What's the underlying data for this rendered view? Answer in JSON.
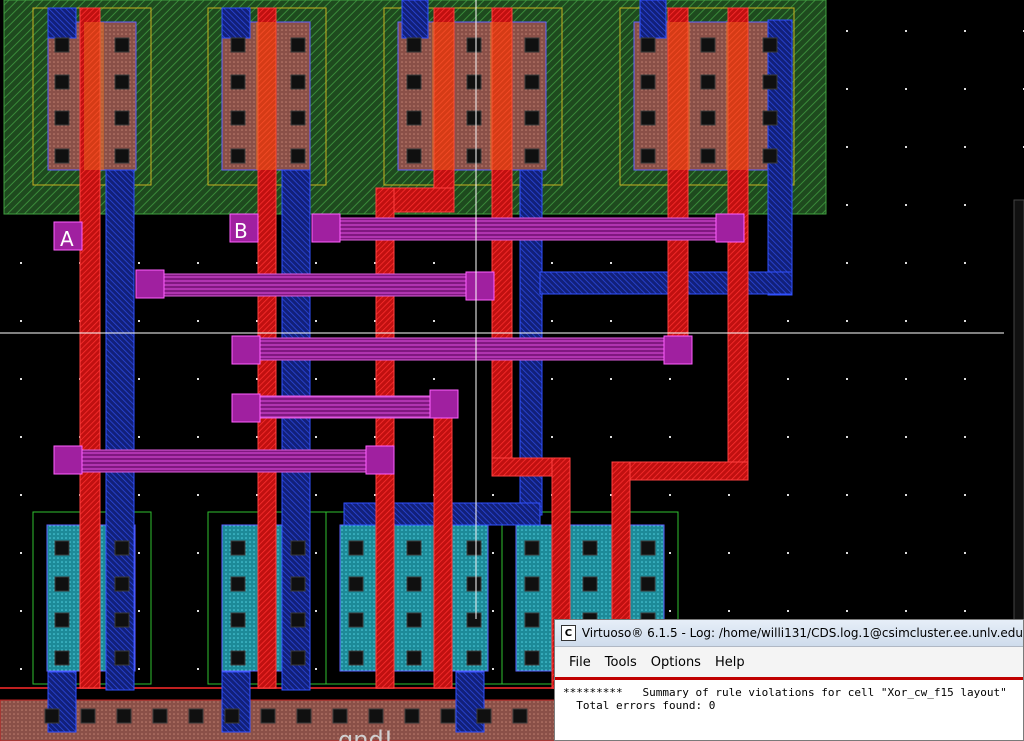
{
  "layout_labels": {
    "pin_a": "A",
    "pin_b": "B",
    "ground_label": "gnd!"
  },
  "colors": {
    "background": "#000000",
    "nwell": "#2f6b2f",
    "poly": "#e01818",
    "metal1": "#1f3fd0",
    "contact": "#c020c0",
    "diffusion": "#b06a5a",
    "ndiff": "#2aa8b8"
  },
  "log_window": {
    "title": "Virtuoso® 6.1.5 - Log: /home/willi131/CDS.log.1@csimcluster.ee.unlv.edu",
    "icon": "C",
    "menu": [
      "File",
      "Tools",
      "Options",
      "Help"
    ],
    "lines": [
      "*********   Summary of rule violations for cell \"Xor_cw_f15 layout\"",
      "  Total errors found: 0"
    ]
  }
}
